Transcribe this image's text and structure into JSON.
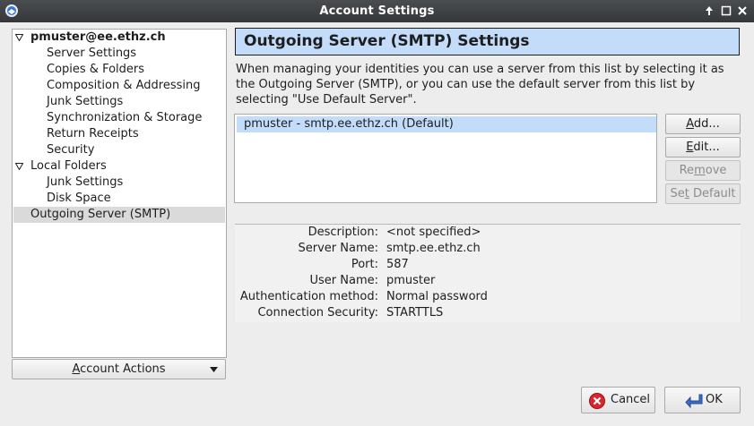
{
  "window": {
    "title": "Account Settings"
  },
  "tree": {
    "account": "pmuster@ee.ethz.ch",
    "account_items": [
      "Server Settings",
      "Copies & Folders",
      "Composition & Addressing",
      "Junk Settings",
      "Synchronization & Storage",
      "Return Receipts",
      "Security"
    ],
    "local_folders": "Local Folders",
    "local_items": [
      "Junk Settings",
      "Disk Space"
    ],
    "outgoing": "Outgoing Server (SMTP)"
  },
  "account_actions": {
    "label_underlined": "A",
    "label_rest": "ccount Actions"
  },
  "panel": {
    "heading": "Outgoing Server (SMTP) Settings",
    "description": [
      "When managing your identities you can use a server from this list by selecting it as",
      "the Outgoing Server (SMTP), or you can use the default server from this list by",
      "selecting \"Use Default Server\"."
    ],
    "servers": [
      "pmuster - smtp.ee.ethz.ch (Default)"
    ]
  },
  "buttons": {
    "add": {
      "pre": "",
      "key": "A",
      "post": "dd..."
    },
    "edit": {
      "pre": "",
      "key": "E",
      "post": "dit..."
    },
    "remove": {
      "pre": "Re",
      "key": "m",
      "post": "ove"
    },
    "set_default": {
      "pre": "Se",
      "key": "t",
      "post": " Default"
    },
    "cancel": "Cancel",
    "ok": "OK"
  },
  "details": [
    {
      "label": "Description:",
      "value": "<not specified>"
    },
    {
      "label": "Server Name:",
      "value": "smtp.ee.ethz.ch"
    },
    {
      "label": "Port:",
      "value": "587"
    },
    {
      "label": "User Name:",
      "value": "pmuster"
    },
    {
      "label": "Authentication method:",
      "value": "Normal password"
    },
    {
      "label": "Connection Security:",
      "value": "STARTTLS"
    }
  ],
  "colors": {
    "titlebar": "#3f4144",
    "header_bg": "#c2dcfa",
    "selection": "#c2dcfa",
    "tree_selected": "#dadada",
    "cancel_red": "#d8262f",
    "ok_blue": "#3c6fc4"
  },
  "icons": {
    "app": "thunderbird-icon",
    "window_controls": [
      "maximize-up-icon",
      "restore-icon",
      "close-icon"
    ],
    "cancel": "cancel-red-circle-icon",
    "ok": "ok-arrow-icon"
  }
}
